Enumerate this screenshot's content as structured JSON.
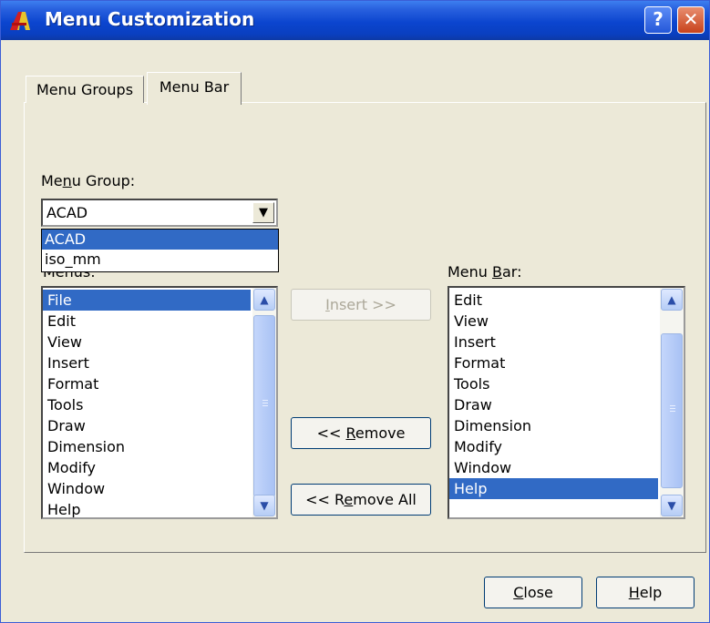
{
  "window": {
    "title": "Menu Customization"
  },
  "title_buttons": {
    "help": "?",
    "close": "✕"
  },
  "tabs": [
    {
      "label": "Menu Groups",
      "active": false
    },
    {
      "label": "Menu Bar",
      "active": true
    }
  ],
  "menu_group": {
    "label_pre": "Me",
    "label_u": "n",
    "label_post": "u Group:",
    "value": "ACAD",
    "options": [
      "ACAD",
      "iso_mm"
    ],
    "selected_option": "ACAD"
  },
  "menus": {
    "label": "Menus:",
    "items": [
      "File",
      "Edit",
      "View",
      "Insert",
      "Format",
      "Tools",
      "Draw",
      "Dimension",
      "Modify",
      "Window",
      "Help"
    ],
    "selected": "File"
  },
  "menu_bar": {
    "label_pre": "Menu ",
    "label_u": "B",
    "label_post": "ar:",
    "items": [
      "Edit",
      "View",
      "Insert",
      "Format",
      "Tools",
      "Draw",
      "Dimension",
      "Modify",
      "Window",
      "Help"
    ],
    "selected": "Help"
  },
  "buttons": {
    "insert": {
      "u": "I",
      "rest": "nsert >>",
      "enabled": false
    },
    "remove": {
      "pre": "<< ",
      "u": "R",
      "rest": "emove"
    },
    "remove_all": {
      "pre": "<< R",
      "u": "e",
      "rest": "move All"
    },
    "close": {
      "u": "C",
      "rest": "lose"
    },
    "help": {
      "u": "H",
      "rest": "elp"
    }
  },
  "colors": {
    "selection": "#316ac5",
    "titlebar": "#0b45cf",
    "face": "#ece9d8"
  }
}
